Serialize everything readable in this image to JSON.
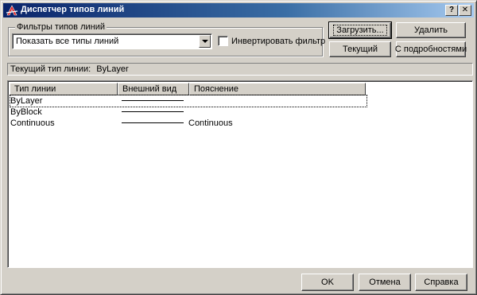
{
  "window": {
    "title": "Диспетчер типов линий",
    "help_button": "?",
    "close_button": "✕"
  },
  "filters": {
    "group_label": "Фильтры типов линий",
    "selected": "Показать все типы линий",
    "invert_label": "Инвертировать фильтр",
    "invert_checked": false
  },
  "buttons": {
    "load": "Загрузить...",
    "delete": "Удалить",
    "current": "Текущий",
    "details": "С подробностями",
    "ok": "OK",
    "cancel": "Отмена",
    "help": "Справка"
  },
  "current_linetype": {
    "label": "Текущий тип линии:",
    "value": "ByLayer"
  },
  "table": {
    "columns": [
      "Тип линии",
      "Внешний вид",
      "Пояснение"
    ],
    "rows": [
      {
        "name": "ByLayer",
        "description": ""
      },
      {
        "name": "ByBlock",
        "description": ""
      },
      {
        "name": "Continuous",
        "description": "Continuous"
      }
    ]
  },
  "colors": {
    "title_bar_start": "#0a246a",
    "title_bar_end": "#a6caf0",
    "dialog_face": "#d4d0c8"
  }
}
